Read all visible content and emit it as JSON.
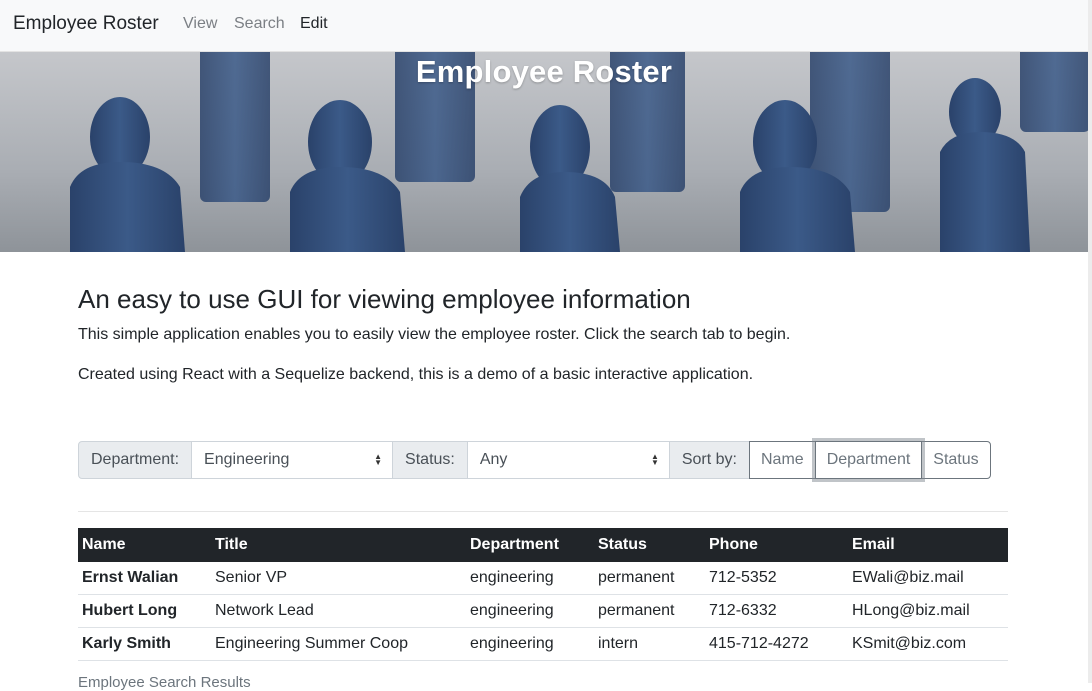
{
  "navbar": {
    "brand": "Employee Roster",
    "links": [
      {
        "label": "View"
      },
      {
        "label": "Search"
      },
      {
        "label": "Edit"
      }
    ]
  },
  "hero": {
    "title": "Employee Roster"
  },
  "intro": {
    "heading": "An easy to use GUI for viewing employee information",
    "paragraph1": "This simple application enables you to easily view the employee roster. Click the search tab to begin.",
    "paragraph2": "Created using React with a Sequelize backend, this is a demo of a basic interactive application."
  },
  "filters": {
    "department_label": "Department:",
    "department_value": "Engineering",
    "status_label": "Status:",
    "status_value": "Any",
    "sort_label": "Sort by:",
    "sort_options": [
      "Name",
      "Department",
      "Status"
    ],
    "sort_focused": "Department"
  },
  "table": {
    "headers": [
      "Name",
      "Title",
      "Department",
      "Status",
      "Phone",
      "Email"
    ],
    "rows": [
      [
        "Ernst Walian",
        "Senior VP",
        "engineering",
        "permanent",
        "712-5352",
        "EWali@biz.mail"
      ],
      [
        "Hubert Long",
        "Network Lead",
        "engineering",
        "permanent",
        "712-6332",
        "HLong@biz.mail"
      ],
      [
        "Karly Smith",
        "Engineering Summer Coop",
        "engineering",
        "intern",
        "415-712-4272",
        "KSmit@biz.com"
      ]
    ],
    "caption": "Employee Search Results"
  },
  "colors": {
    "table_header_bg": "#212529",
    "figure_blue": "#35507a"
  },
  "icons": {
    "select_caret": "up-down-caret-icon"
  }
}
